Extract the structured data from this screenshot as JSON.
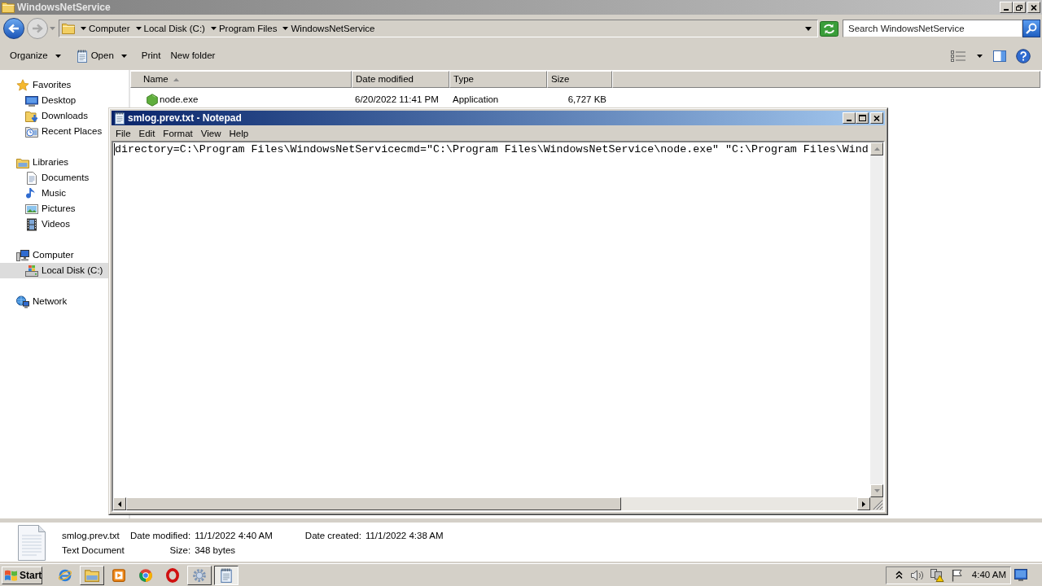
{
  "explorer": {
    "title": "WindowsNetService",
    "active": false
  },
  "navigation": {
    "back": {
      "disabled": false
    },
    "forward": {
      "disabled": true
    }
  },
  "address_bar": {
    "crumbs": [
      "Computer",
      "Local Disk (C:)",
      "Program Files",
      "WindowsNetService"
    ]
  },
  "search": {
    "placeholder": "Search WindowsNetService"
  },
  "toolbar": {
    "buttons": [
      {
        "kind": "menu",
        "label": "Organize"
      },
      {
        "kind": "app",
        "label": "Open"
      },
      {
        "kind": "plain",
        "label": "Print"
      },
      {
        "kind": "plain",
        "label": "New folder"
      }
    ]
  },
  "sidebar": {
    "items": [
      {
        "kind": "favorites",
        "label": "Favorites",
        "selected": false,
        "children": [
          {
            "kind": "desktop",
            "label": "Desktop",
            "selected": false
          },
          {
            "kind": "downloads",
            "label": "Downloads",
            "selected": false
          },
          {
            "kind": "recent",
            "label": "Recent Places",
            "selected": false
          }
        ]
      },
      {
        "kind": "libraries",
        "label": "Libraries",
        "selected": false,
        "children": [
          {
            "kind": "documents",
            "label": "Documents",
            "selected": false
          },
          {
            "kind": "music",
            "label": "Music",
            "selected": false
          },
          {
            "kind": "pictures",
            "label": "Pictures",
            "selected": false
          },
          {
            "kind": "videos",
            "label": "Videos",
            "selected": false
          }
        ]
      },
      {
        "kind": "computer",
        "label": "Computer",
        "selected": false,
        "children": [
          {
            "kind": "drive",
            "label": "Local Disk (C:)",
            "selected": true
          }
        ]
      },
      {
        "kind": "network",
        "label": "Network",
        "selected": false
      }
    ]
  },
  "file_list": {
    "columns": [
      {
        "label": "Name",
        "sorted": true
      },
      {
        "label": "Date modified",
        "sorted": false
      },
      {
        "label": "Type",
        "sorted": false
      },
      {
        "label": "Size",
        "sorted": false
      }
    ],
    "rows": [
      {
        "selected": false,
        "cells": [
          "node.exe",
          "6/20/2022 11:41 PM",
          "Application",
          "6,727 KB"
        ]
      }
    ]
  },
  "notepad": {
    "title": "smlog.prev.txt - Notepad",
    "active": true,
    "menu": [
      "File",
      "Edit",
      "Format",
      "View",
      "Help"
    ],
    "text": "directory=C:\\Program Files\\WindowsNetServicecmd=\"C:\\Program Files\\WindowsNetService\\node.exe\" \"C:\\Program Files\\Wind"
  },
  "details_pane": {
    "name": "smlog.prev.txt",
    "type": "Text Document",
    "property_columns": [
      [
        {
          "label": "Date modified:",
          "value": "11/1/2022 4:40 AM"
        },
        {
          "label": "Size:",
          "value": "348 bytes"
        }
      ],
      [
        {
          "label": "Date created:",
          "value": "11/1/2022 4:38 AM"
        }
      ]
    ]
  },
  "taskbar": {
    "start": "Start",
    "items": [
      {
        "kind": "browser",
        "running": false,
        "selected": false
      },
      {
        "kind": "folder",
        "running": true,
        "selected": false
      },
      {
        "kind": "player",
        "running": false,
        "selected": false
      },
      {
        "kind": "circle",
        "running": false,
        "selected": false
      },
      {
        "kind": "ring",
        "running": false,
        "selected": false
      },
      {
        "kind": "gear",
        "running": true,
        "selected": false
      },
      {
        "kind": "notepad",
        "running": true,
        "selected": true
      }
    ],
    "clock": "4:40 AM"
  }
}
